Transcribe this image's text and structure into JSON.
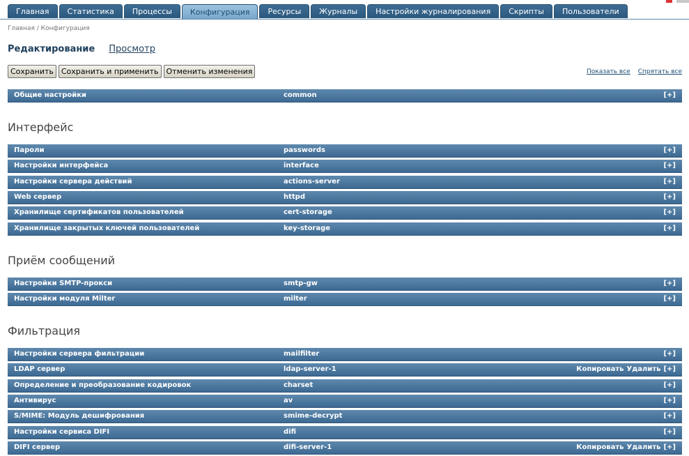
{
  "nav": {
    "tabs": [
      {
        "label": "Главная"
      },
      {
        "label": "Статистика"
      },
      {
        "label": "Процессы"
      },
      {
        "label": "Конфигурация"
      },
      {
        "label": "Ресурсы"
      },
      {
        "label": "Журналы"
      },
      {
        "label": "Настройки журналирования"
      },
      {
        "label": "Скрипты"
      },
      {
        "label": "Пользователи"
      }
    ],
    "active": "Конфигурация"
  },
  "breadcrumb": "Главная / Конфигурация",
  "modes": {
    "edit": "Редактирование",
    "view": "Просмотр"
  },
  "toolbar": {
    "save": "Сохранить",
    "save_apply": "Сохранить и применить",
    "revert": "Отменить изменения"
  },
  "showhide": {
    "show_all": "Показать все",
    "hide_all": "Спрятать все"
  },
  "row_labels": {
    "expand": "[+]",
    "copy": "Копировать",
    "delete": "Удалить"
  },
  "general": {
    "title": "Общие настройки",
    "id": "common"
  },
  "sections": [
    {
      "title": "Интерфейс",
      "rows": [
        {
          "title": "Пароли",
          "id": "passwords"
        },
        {
          "title": "Настройки интерфейса",
          "id": "interface"
        },
        {
          "title": "Настройки сервера действий",
          "id": "actions-server"
        },
        {
          "title": "Web сервер",
          "id": "httpd"
        },
        {
          "title": "Хранилище сертификатов пользователей",
          "id": "cert-storage"
        },
        {
          "title": "Хранилище закрытых ключей пользователей",
          "id": "key-storage"
        }
      ]
    },
    {
      "title": "Приём сообщений",
      "rows": [
        {
          "title": "Настройки SMTP-прокси",
          "id": "smtp-gw"
        },
        {
          "title": "Настройки модуля Milter",
          "id": "milter"
        }
      ]
    },
    {
      "title": "Фильтрация",
      "rows": [
        {
          "title": "Настройки сервера фильтрации",
          "id": "mailfilter"
        },
        {
          "title": "LDAP сервер",
          "id": "ldap-server-1",
          "copyable": true
        },
        {
          "title": "Определение и преобразование кодировок",
          "id": "charset"
        },
        {
          "title": "Антивирус",
          "id": "av"
        },
        {
          "title": "S/MIME: Модуль дешифрования",
          "id": "smime-decrypt"
        },
        {
          "title": "Настройки сервиса DIFI",
          "id": "difi"
        },
        {
          "title": "DIFI сервер",
          "id": "difi-server-1",
          "copyable": true
        }
      ]
    }
  ],
  "colors": {
    "accent": "#3d6a93",
    "active_tab": "#9cc3e0"
  }
}
